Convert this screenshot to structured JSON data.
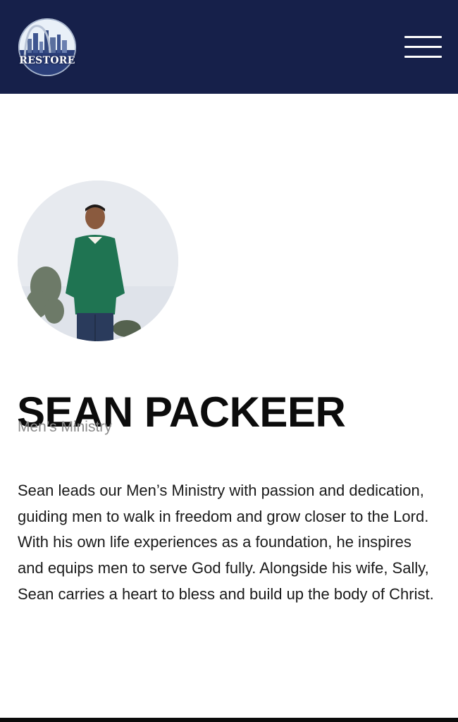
{
  "header": {
    "logo_text": "RESTORE",
    "menu_icon": "hamburger-menu-icon",
    "background_color": "#16204a"
  },
  "profile": {
    "name": "SEAN PACKEER",
    "role": "Men’s Ministry",
    "bio": "Sean leads our Men’s Ministry with passion and dedication, guiding men to walk in freedom and grow closer to the Lord. With his own life experiences as a foundation, he inspires and equips men to serve God fully. Alongside his wife, Sally, Sean carries a heart to bless and build up the body of Christ."
  },
  "colors": {
    "name": "#0c0c0c",
    "role": "#8a8a8a",
    "text": "#1a1a1a"
  }
}
